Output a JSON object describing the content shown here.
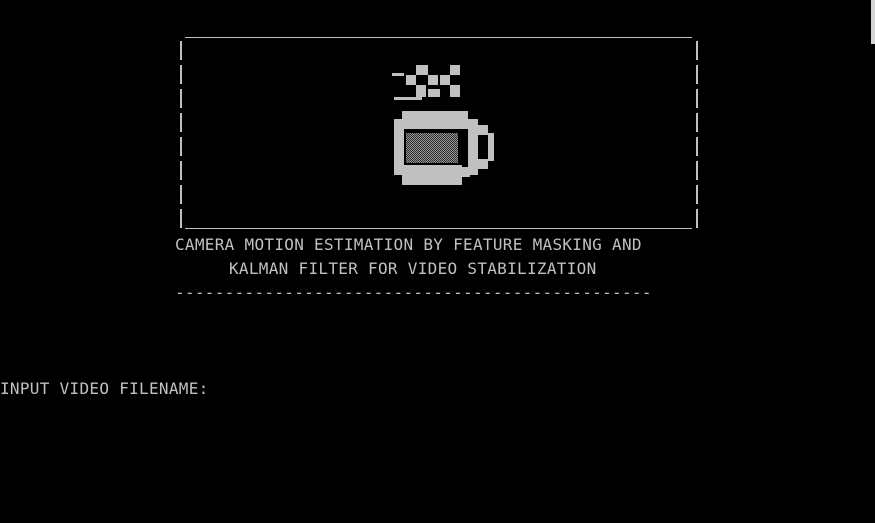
{
  "console": {
    "background": "#000000",
    "foreground": "#c0c0c0"
  },
  "banner": {
    "icon": "coffee-cup-icon",
    "title_line_1": "CAMERA MOTION ESTIMATION BY FEATURE MASKING AND",
    "title_line_2": "KALMAN FILTER FOR VIDEO STABILIZATION",
    "separator": "------------------------------------------------"
  },
  "prompt": {
    "label": "INPUT VIDEO FILENAME:",
    "value": ""
  }
}
